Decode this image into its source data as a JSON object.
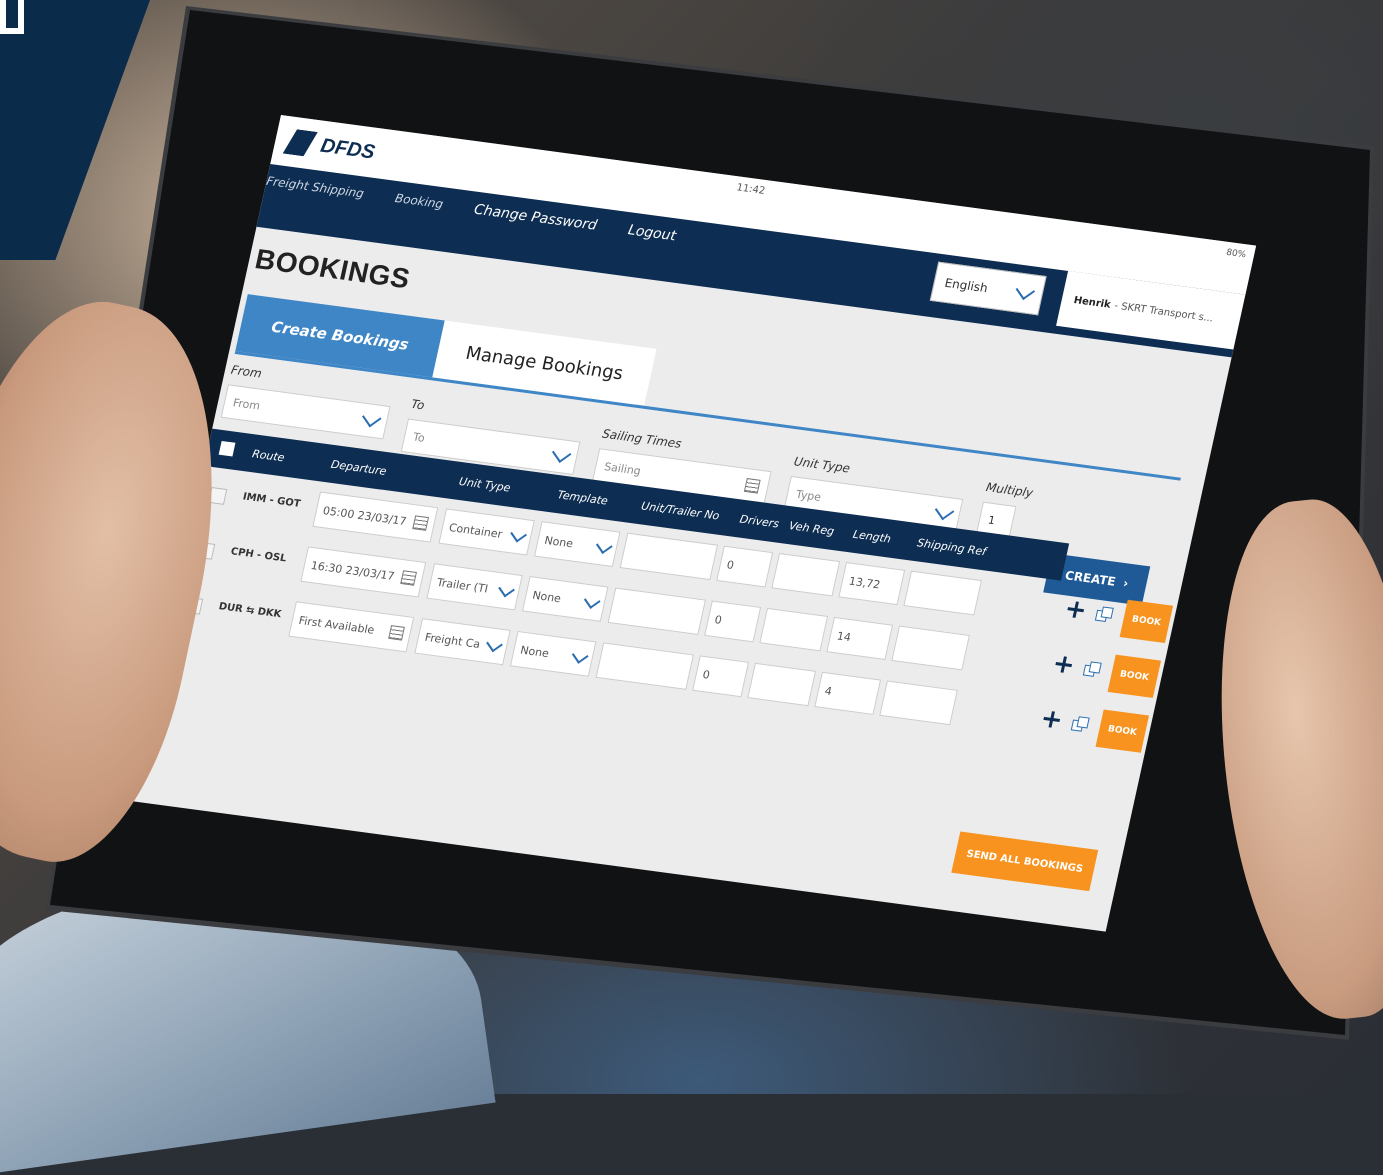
{
  "app": {
    "brand": "DFDS",
    "status_time": "11:42",
    "battery": "80%"
  },
  "nav": {
    "items": [
      "Freight Shipping",
      "Booking",
      "Change Password",
      "Logout"
    ],
    "language": "English",
    "user_name": "Henrik",
    "user_company": "- SKRT Transport s..."
  },
  "page": {
    "title": "BOOKINGS",
    "tabs": [
      {
        "label": "Create Bookings",
        "active": true
      },
      {
        "label": "Manage Bookings",
        "active": false
      }
    ]
  },
  "filters": {
    "from_label": "From",
    "from_placeholder": "From",
    "to_label": "To",
    "to_placeholder": "To",
    "sailing_label": "Sailing Times",
    "sailing_placeholder": "Sailing",
    "unit_label": "Unit Type",
    "unit_placeholder": "Type",
    "multiply_label": "Multiply",
    "multiply_value": "1",
    "create_label": "CREATE",
    "create_arrow": "›"
  },
  "table": {
    "headers": [
      "Route",
      "Departure",
      "Unit Type",
      "Template",
      "Unit/Trailer No",
      "Drivers",
      "Veh Reg",
      "Length",
      "Shipping Ref"
    ],
    "rows": [
      {
        "route": "IMM - GOT",
        "departure": "05:00 23/03/17",
        "unit_type": "Container",
        "template": "None",
        "trailer_no": "",
        "drivers": "0",
        "veh_reg": "",
        "length": "13,72",
        "shipping_ref": ""
      },
      {
        "route": "CPH - OSL",
        "departure": "16:30 23/03/17",
        "unit_type": "Trailer (TI",
        "template": "None",
        "trailer_no": "",
        "drivers": "0",
        "veh_reg": "",
        "length": "14",
        "shipping_ref": ""
      },
      {
        "route": "DUR ⇆ DKK",
        "departure": "First Available",
        "unit_type": "Freight Ca",
        "template": "None",
        "trailer_no": "",
        "drivers": "0",
        "veh_reg": "",
        "length": "4",
        "shipping_ref": ""
      }
    ],
    "add_glyph": "+",
    "book_label": "BOOK"
  },
  "footer": {
    "send_all_label": "SEND ALL BOOKINGS"
  },
  "colors": {
    "navy": "#0d2d52",
    "tab_blue": "#3f86c6",
    "orange": "#f7931e"
  }
}
